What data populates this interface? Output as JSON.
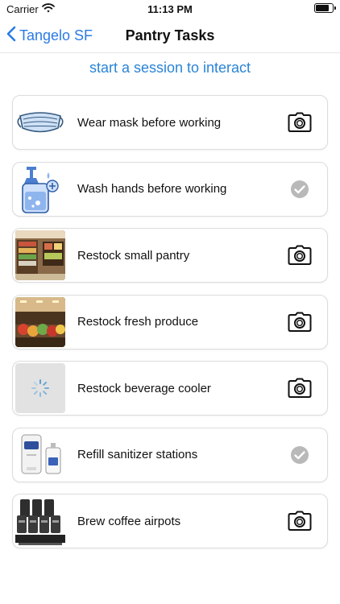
{
  "status_bar": {
    "carrier": "Carrier",
    "time": "11:13 PM",
    "wifi_icon": "wifi-icon",
    "battery_icon": "battery-icon"
  },
  "nav": {
    "back_label": "Tangelo SF",
    "title": "Pantry Tasks"
  },
  "session_hint": "start a session to interact",
  "colors": {
    "accent": "#2a7be4",
    "completed_gray": "#b9b9b9"
  },
  "tasks": [
    {
      "label": "Wear mask before working",
      "thumbnail": "face-mask-icon",
      "status": "photo-required",
      "action_icon": "camera-icon"
    },
    {
      "label": "Wash hands before working",
      "thumbnail": "soap-dispenser-icon",
      "status": "completed",
      "action_icon": "checkmark-circle-icon"
    },
    {
      "label": "Restock small pantry",
      "thumbnail": "pantry-shelves-photo",
      "status": "photo-required",
      "action_icon": "camera-icon"
    },
    {
      "label": "Restock fresh produce",
      "thumbnail": "produce-stand-photo",
      "status": "photo-required",
      "action_icon": "camera-icon"
    },
    {
      "label": "Restock beverage cooler",
      "thumbnail": "loading-spinner-icon",
      "status": "photo-required",
      "action_icon": "camera-icon"
    },
    {
      "label": "Refill sanitizer stations",
      "thumbnail": "sanitizer-dispenser-photo",
      "status": "completed",
      "action_icon": "checkmark-circle-icon"
    },
    {
      "label": "Brew coffee airpots",
      "thumbnail": "coffee-airpots-photo",
      "status": "photo-required",
      "action_icon": "camera-icon"
    }
  ]
}
